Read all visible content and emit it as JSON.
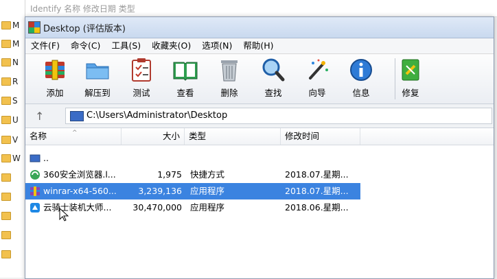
{
  "background": {
    "top_text": "Identify   名称                                              修改日期              类型",
    "left_letters": [
      "M",
      "M",
      "N",
      "R",
      "S",
      "U",
      "V",
      "W"
    ]
  },
  "window": {
    "title": "Desktop (评估版本)",
    "menu": [
      "文件(F)",
      "命令(C)",
      "工具(S)",
      "收藏夹(O)",
      "选项(N)",
      "帮助(H)"
    ],
    "toolbar": [
      {
        "label": "添加",
        "icon": "add-archive-icon"
      },
      {
        "label": "解压到",
        "icon": "extract-folder-icon"
      },
      {
        "label": "测试",
        "icon": "test-clipboard-icon"
      },
      {
        "label": "查看",
        "icon": "view-book-icon"
      },
      {
        "label": "删除",
        "icon": "trash-icon"
      },
      {
        "label": "查找",
        "icon": "magnifier-icon"
      },
      {
        "label": "向导",
        "icon": "wizard-wand-icon"
      },
      {
        "label": "信息",
        "icon": "info-icon"
      },
      {
        "label": "修复",
        "icon": "repair-kit-icon"
      }
    ],
    "address": "C:\\Users\\Administrator\\Desktop",
    "columns": {
      "name": "名称",
      "size": "大小",
      "type": "类型",
      "modified": "修改时间"
    },
    "rows": [
      {
        "name": "..",
        "size": "",
        "type": "",
        "modified": "",
        "icon": "parent-folder-icon"
      },
      {
        "name": "360安全浏览器.l...",
        "size": "1,975",
        "type": "快捷方式",
        "modified": "2018.07.星期...",
        "icon": "browser-360-icon"
      },
      {
        "name": "winrar-x64-560...",
        "size": "3,239,136",
        "type": "应用程序",
        "modified": "2018.07.星期...",
        "icon": "winrar-icon",
        "selected": true
      },
      {
        "name": "云骑士装机大师...",
        "size": "30,470,000",
        "type": "应用程序",
        "modified": "2018.06.星期...",
        "icon": "yunqishi-icon"
      }
    ]
  },
  "colors": {
    "selection": "#3b83e0",
    "accent": "#2e86de"
  }
}
